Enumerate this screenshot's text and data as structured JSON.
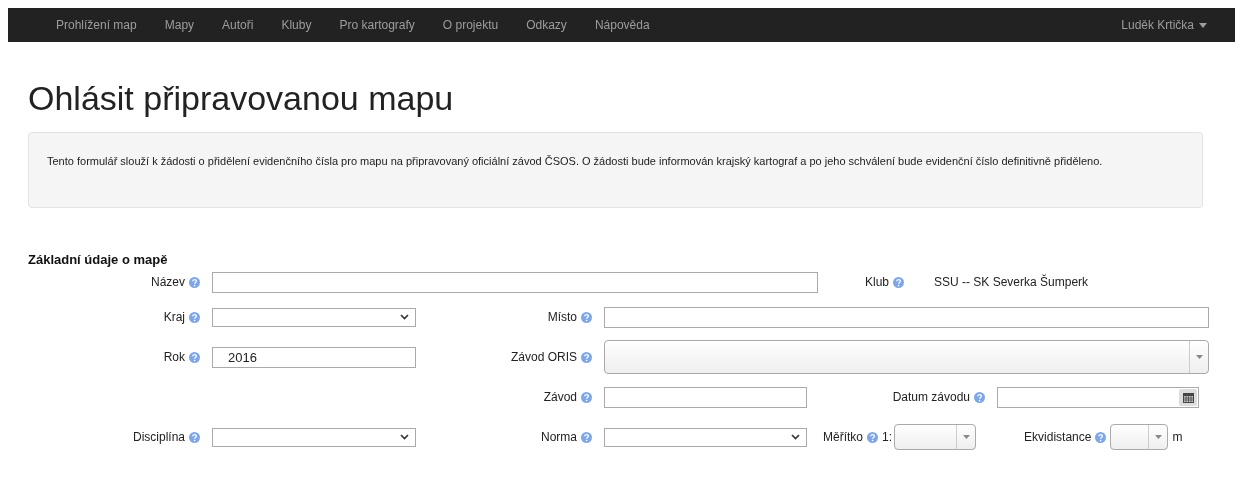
{
  "navbar": {
    "items": [
      {
        "label": "Prohlížení map",
        "selected": false
      },
      {
        "label": "Mapy",
        "selected": false
      },
      {
        "label": "Autoři",
        "selected": false
      },
      {
        "label": "Kluby",
        "selected": false
      },
      {
        "label": "Pro kartografy",
        "selected": false
      },
      {
        "label": "O projektu",
        "selected": false
      },
      {
        "label": "Odkazy",
        "selected": false
      },
      {
        "label": "Nápověda",
        "selected": false
      }
    ],
    "user": "Luděk Krtička"
  },
  "title": "Ohlásit připravovanou mapu",
  "info": "Tento formulář slouží k žádosti o přidělení evidenčního čísla pro mapu na připravovaný oficiální závod ČSOS. O žádosti bude informován krajský kartograf a po jeho schválení bude evidenční číslo definitivně přiděleno.",
  "section": "Základní údaje o mapě",
  "rows": [
    [
      {
        "label": "Název",
        "kind": "text"
      },
      {
        "label": "Klub",
        "kind": "static",
        "value": "SSU -- SK Severka Šumperk"
      }
    ],
    [
      {
        "label": "Kraj",
        "kind": "select"
      },
      {
        "label": "Místo",
        "kind": "text"
      }
    ],
    [
      {
        "label": "Rok",
        "kind": "text",
        "value": "2016"
      },
      {
        "label": "Závod ORIS",
        "kind": "combo"
      }
    ],
    [
      {
        "label": "Závod",
        "kind": "text"
      },
      {
        "label": "Datum závodu",
        "kind": "date"
      }
    ],
    [
      {
        "label": "Disciplína",
        "kind": "select"
      },
      {
        "label": "Norma",
        "kind": "select"
      },
      {
        "label": "Měřítko",
        "kind": "combo",
        "prefix": "1:"
      },
      {
        "label": "Ekvidistance",
        "kind": "combo",
        "suffix": "m"
      }
    ]
  ]
}
